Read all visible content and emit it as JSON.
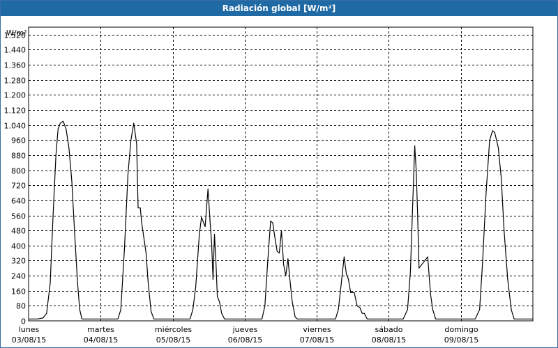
{
  "window": {
    "title": "Radiación global [W/m²]"
  },
  "chart_data": {
    "type": "line",
    "title": "Radiación global [W/m²]",
    "ylabel": "W/m²",
    "ylim": [
      0,
      1560
    ],
    "yticks": [
      0,
      80,
      160,
      240,
      320,
      400,
      480,
      560,
      640,
      720,
      800,
      880,
      960,
      1040,
      1120,
      1200,
      1280,
      1360,
      1440,
      1520
    ],
    "ytick_labels": [
      "0",
      "80",
      "160",
      "240",
      "320",
      "400",
      "480",
      "560",
      "640",
      "720",
      "800",
      "880",
      "960",
      "1.040",
      "1.120",
      "1.200",
      "1.280",
      "1.360",
      "1.440",
      "1.520"
    ],
    "xlim": [
      0,
      7
    ],
    "x_unit": "days from 03/08/15 00:00",
    "day_labels": [
      {
        "day": "lunes",
        "date": "03/08/15"
      },
      {
        "day": "martes",
        "date": "04/08/15"
      },
      {
        "day": "miércoles",
        "date": "05/08/15"
      },
      {
        "day": "jueves",
        "date": "06/08/15"
      },
      {
        "day": "viernes",
        "date": "07/08/15"
      },
      {
        "day": "sábado",
        "date": "08/08/15"
      },
      {
        "day": "domingo",
        "date": "09/08/15"
      }
    ],
    "grid": true,
    "color": "#000000",
    "series": [
      {
        "values": [
          [
            0.0,
            10
          ],
          [
            0.12,
            10
          ],
          [
            0.2,
            15
          ],
          [
            0.25,
            40
          ],
          [
            0.3,
            200
          ],
          [
            0.34,
            560
          ],
          [
            0.38,
            880
          ],
          [
            0.41,
            1020
          ],
          [
            0.44,
            1050
          ],
          [
            0.48,
            1060
          ],
          [
            0.52,
            1020
          ],
          [
            0.56,
            920
          ],
          [
            0.6,
            740
          ],
          [
            0.64,
            460
          ],
          [
            0.68,
            200
          ],
          [
            0.71,
            60
          ],
          [
            0.74,
            10
          ],
          [
            1.24,
            10
          ],
          [
            1.28,
            60
          ],
          [
            1.33,
            380
          ],
          [
            1.38,
            780
          ],
          [
            1.42,
            960
          ],
          [
            1.46,
            1050
          ],
          [
            1.5,
            940
          ],
          [
            1.52,
            600
          ],
          [
            1.55,
            600
          ],
          [
            1.57,
            520
          ],
          [
            1.6,
            440
          ],
          [
            1.63,
            360
          ],
          [
            1.66,
            200
          ],
          [
            1.7,
            50
          ],
          [
            1.74,
            10
          ],
          [
            2.24,
            10
          ],
          [
            2.28,
            60
          ],
          [
            2.32,
            180
          ],
          [
            2.37,
            460
          ],
          [
            2.4,
            550
          ],
          [
            2.45,
            500
          ],
          [
            2.49,
            700
          ],
          [
            2.52,
            520
          ],
          [
            2.54,
            420
          ],
          [
            2.56,
            220
          ],
          [
            2.58,
            460
          ],
          [
            2.6,
            320
          ],
          [
            2.62,
            130
          ],
          [
            2.65,
            100
          ],
          [
            2.68,
            40
          ],
          [
            2.72,
            10
          ],
          [
            3.24,
            10
          ],
          [
            3.28,
            80
          ],
          [
            3.32,
            320
          ],
          [
            3.36,
            530
          ],
          [
            3.39,
            520
          ],
          [
            3.42,
            440
          ],
          [
            3.45,
            370
          ],
          [
            3.48,
            360
          ],
          [
            3.51,
            480
          ],
          [
            3.54,
            300
          ],
          [
            3.57,
            240
          ],
          [
            3.6,
            330
          ],
          [
            3.63,
            210
          ],
          [
            3.66,
            100
          ],
          [
            3.7,
            20
          ],
          [
            3.73,
            10
          ],
          [
            4.26,
            10
          ],
          [
            4.3,
            60
          ],
          [
            4.34,
            200
          ],
          [
            4.38,
            340
          ],
          [
            4.41,
            250
          ],
          [
            4.44,
            220
          ],
          [
            4.47,
            150
          ],
          [
            4.52,
            150
          ],
          [
            4.56,
            80
          ],
          [
            4.6,
            70
          ],
          [
            4.63,
            40
          ],
          [
            4.66,
            40
          ],
          [
            4.7,
            10
          ],
          [
            5.2,
            10
          ],
          [
            5.26,
            60
          ],
          [
            5.3,
            260
          ],
          [
            5.33,
            600
          ],
          [
            5.36,
            930
          ],
          [
            5.38,
            800
          ],
          [
            5.4,
            570
          ],
          [
            5.42,
            280
          ],
          [
            5.46,
            300
          ],
          [
            5.5,
            320
          ],
          [
            5.54,
            340
          ],
          [
            5.58,
            140
          ],
          [
            5.61,
            60
          ],
          [
            5.65,
            10
          ],
          [
            6.2,
            10
          ],
          [
            6.26,
            60
          ],
          [
            6.3,
            300
          ],
          [
            6.35,
            680
          ],
          [
            6.4,
            960
          ],
          [
            6.44,
            1010
          ],
          [
            6.47,
            1000
          ],
          [
            6.52,
            920
          ],
          [
            6.56,
            760
          ],
          [
            6.6,
            480
          ],
          [
            6.65,
            220
          ],
          [
            6.7,
            60
          ],
          [
            6.74,
            10
          ],
          [
            7.0,
            10
          ]
        ]
      }
    ]
  }
}
